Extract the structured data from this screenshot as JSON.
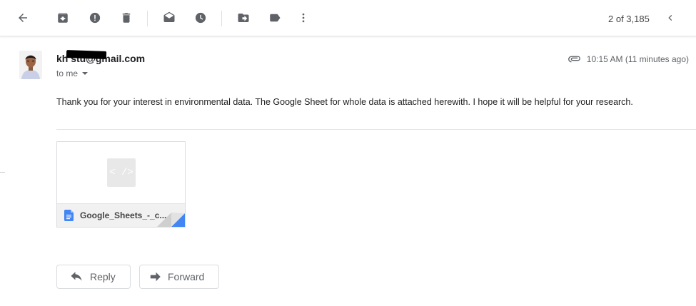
{
  "toolbar": {
    "icons": [
      "back-icon",
      "archive-icon",
      "report-spam-icon",
      "delete-icon",
      "mark-unread-icon",
      "snooze-icon",
      "move-to-icon",
      "labels-icon",
      "more-vert-icon",
      "prev-icon"
    ],
    "count": "2 of 3,185"
  },
  "message": {
    "sender_email": "kh       stu@gmail.com",
    "recipient": "to me",
    "timestamp": "10:15 AM (11 minutes ago)",
    "body": "Thank you for your interest in environmental data. The Google Sheet for whole data is attached herewith. I hope it will be helpful for your research."
  },
  "attachment": {
    "thumbnail_glyph": "< />",
    "filename": "Google_Sheets_-_c..."
  },
  "actions": {
    "reply_label": "Reply",
    "forward_label": "Forward"
  },
  "colors": {
    "icon_gray": "#5f6368",
    "doc_blue": "#4285f4"
  }
}
